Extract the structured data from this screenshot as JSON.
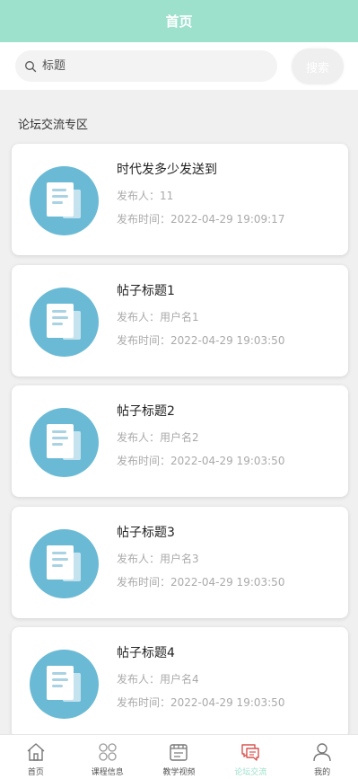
{
  "header": {
    "title": "首页"
  },
  "search": {
    "placeholder": "标题",
    "button_label": "搜索"
  },
  "section": {
    "title": "论坛交流专区"
  },
  "posts": [
    {
      "title": "时代发多少发送到",
      "author": "发布人：11",
      "time": "发布时间：2022-04-29 19:09:17"
    },
    {
      "title": "帖子标题1",
      "author": "发布人：用户名1",
      "time": "发布时间：2022-04-29 19:03:50"
    },
    {
      "title": "帖子标题2",
      "author": "发布人：用户名2",
      "time": "发布时间：2022-04-29 19:03:50"
    },
    {
      "title": "帖子标题3",
      "author": "发布人：用户名3",
      "time": "发布时间：2022-04-29 19:03:50"
    },
    {
      "title": "帖子标题4",
      "author": "发布人：用户名4",
      "time": "发布时间：2022-04-29 19:03:50"
    }
  ],
  "tabbar": {
    "items": [
      {
        "label": "首页",
        "icon": "home-icon"
      },
      {
        "label": "课程信息",
        "icon": "grid-icon"
      },
      {
        "label": "教学视频",
        "icon": "video-icon"
      },
      {
        "label": "论坛交流",
        "icon": "chat-icon",
        "active": true
      },
      {
        "label": "我的",
        "icon": "user-icon"
      }
    ]
  },
  "colors": {
    "accent": "#9de0cc",
    "thumb": "#6bbad5",
    "active_icon": "#d9534f"
  }
}
